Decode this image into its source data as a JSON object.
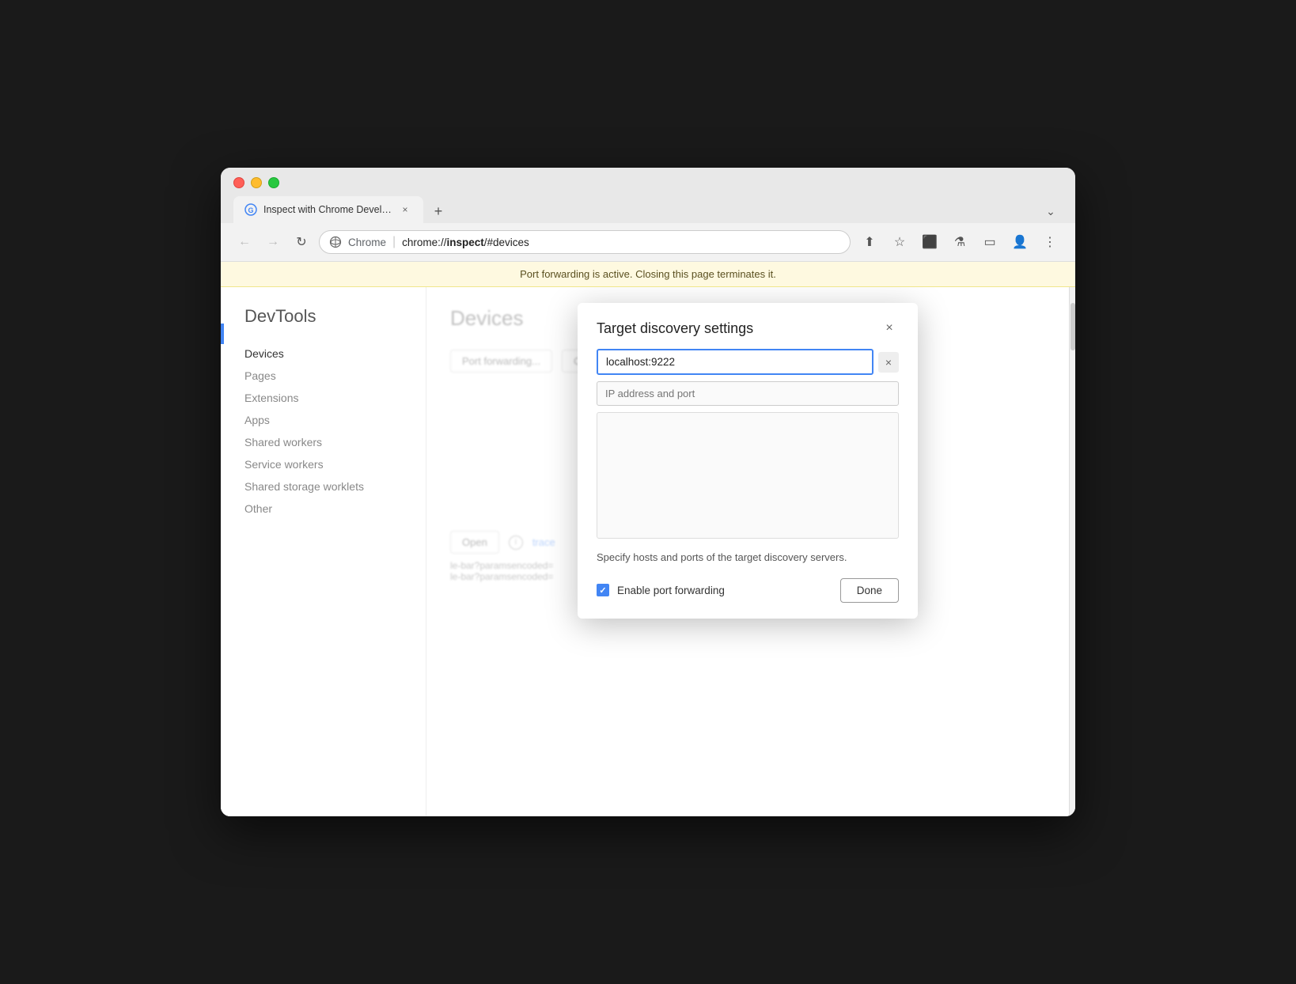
{
  "browser": {
    "traffic_lights": [
      "close",
      "minimize",
      "maximize"
    ],
    "tab": {
      "title": "Inspect with Chrome Develope",
      "url_display": "chrome://inspect/#devices",
      "url_bold_part": "inspect",
      "url_prefix": "chrome://",
      "url_suffix": "/#devices",
      "chrome_label": "Chrome"
    },
    "new_tab_label": "+",
    "chevron_label": "⌄"
  },
  "toolbar": {
    "back_icon": "←",
    "forward_icon": "→",
    "reload_icon": "↻",
    "share_icon": "⬆",
    "bookmark_icon": "☆",
    "extensions_icon": "⬛",
    "devtools_icon": "⚗",
    "sidebar_icon": "▭",
    "profile_icon": "👤",
    "menu_icon": "⋮"
  },
  "banner": {
    "text": "Port forwarding is active. Closing this page terminates it."
  },
  "sidebar": {
    "title": "DevTools",
    "nav_items": [
      {
        "label": "Devices",
        "active": true
      },
      {
        "label": "Pages",
        "active": false
      },
      {
        "label": "Extensions",
        "active": false
      },
      {
        "label": "Apps",
        "active": false
      },
      {
        "label": "Shared workers",
        "active": false
      },
      {
        "label": "Service workers",
        "active": false
      },
      {
        "label": "Shared storage worklets",
        "active": false
      },
      {
        "label": "Other",
        "active": false
      }
    ]
  },
  "page": {
    "title": "Devices"
  },
  "background": {
    "port_fwd_btn": "Port forwarding...",
    "configure_btn": "Configure...",
    "open_btn": "Open",
    "trace_label": "trace",
    "url1": "le-bar?paramsencoded=",
    "url2": "le-bar?paramsencoded="
  },
  "modal": {
    "title": "Target discovery settings",
    "close_label": "×",
    "input_value": "localhost:9222",
    "input_clear_label": "×",
    "placeholder": "IP address and port",
    "description": "Specify hosts and ports of the target discovery servers.",
    "checkbox": {
      "label": "Enable port forwarding",
      "checked": true
    },
    "done_button": "Done"
  }
}
